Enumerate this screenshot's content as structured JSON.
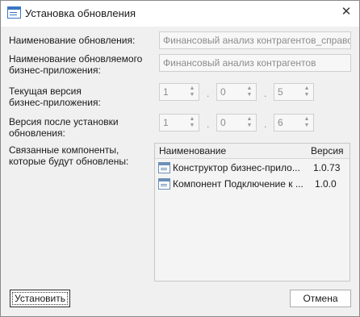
{
  "window": {
    "title": "Установка обновления",
    "close_glyph": "✕"
  },
  "labels": {
    "update_name": "Наименование обновления:",
    "app_name_line1": "Наименование обновляемого",
    "app_name_line2": "бизнес-приложения:",
    "current_version_line1": "Текущая версия",
    "current_version_line2": "бизнес-приложения:",
    "new_version_line1": "Версия после установки",
    "new_version_line2": "обновления:",
    "components_line1": "Связанные компоненты,",
    "components_line2": "которые будут обновлены:"
  },
  "fields": {
    "update_name": "Финансовый анализ контрагентов_справочни",
    "app_name": "Финансовый анализ контрагентов"
  },
  "current_version": [
    "1",
    "0",
    "5"
  ],
  "new_version": [
    "1",
    "0",
    "6"
  ],
  "version_separator": ".",
  "spin_up_glyph": "▲",
  "spin_down_glyph": "▼",
  "components_table": {
    "columns": [
      "Наименование",
      "Версия"
    ],
    "rows": [
      {
        "name": "Конструктор бизнес-прило...",
        "version": "1.0.73",
        "icon": "component-icon"
      },
      {
        "name": "Компонент Подключение к ...",
        "version": "1.0.0",
        "icon": "component-icon"
      }
    ]
  },
  "buttons": {
    "install": "Установить",
    "cancel": "Отмена"
  }
}
